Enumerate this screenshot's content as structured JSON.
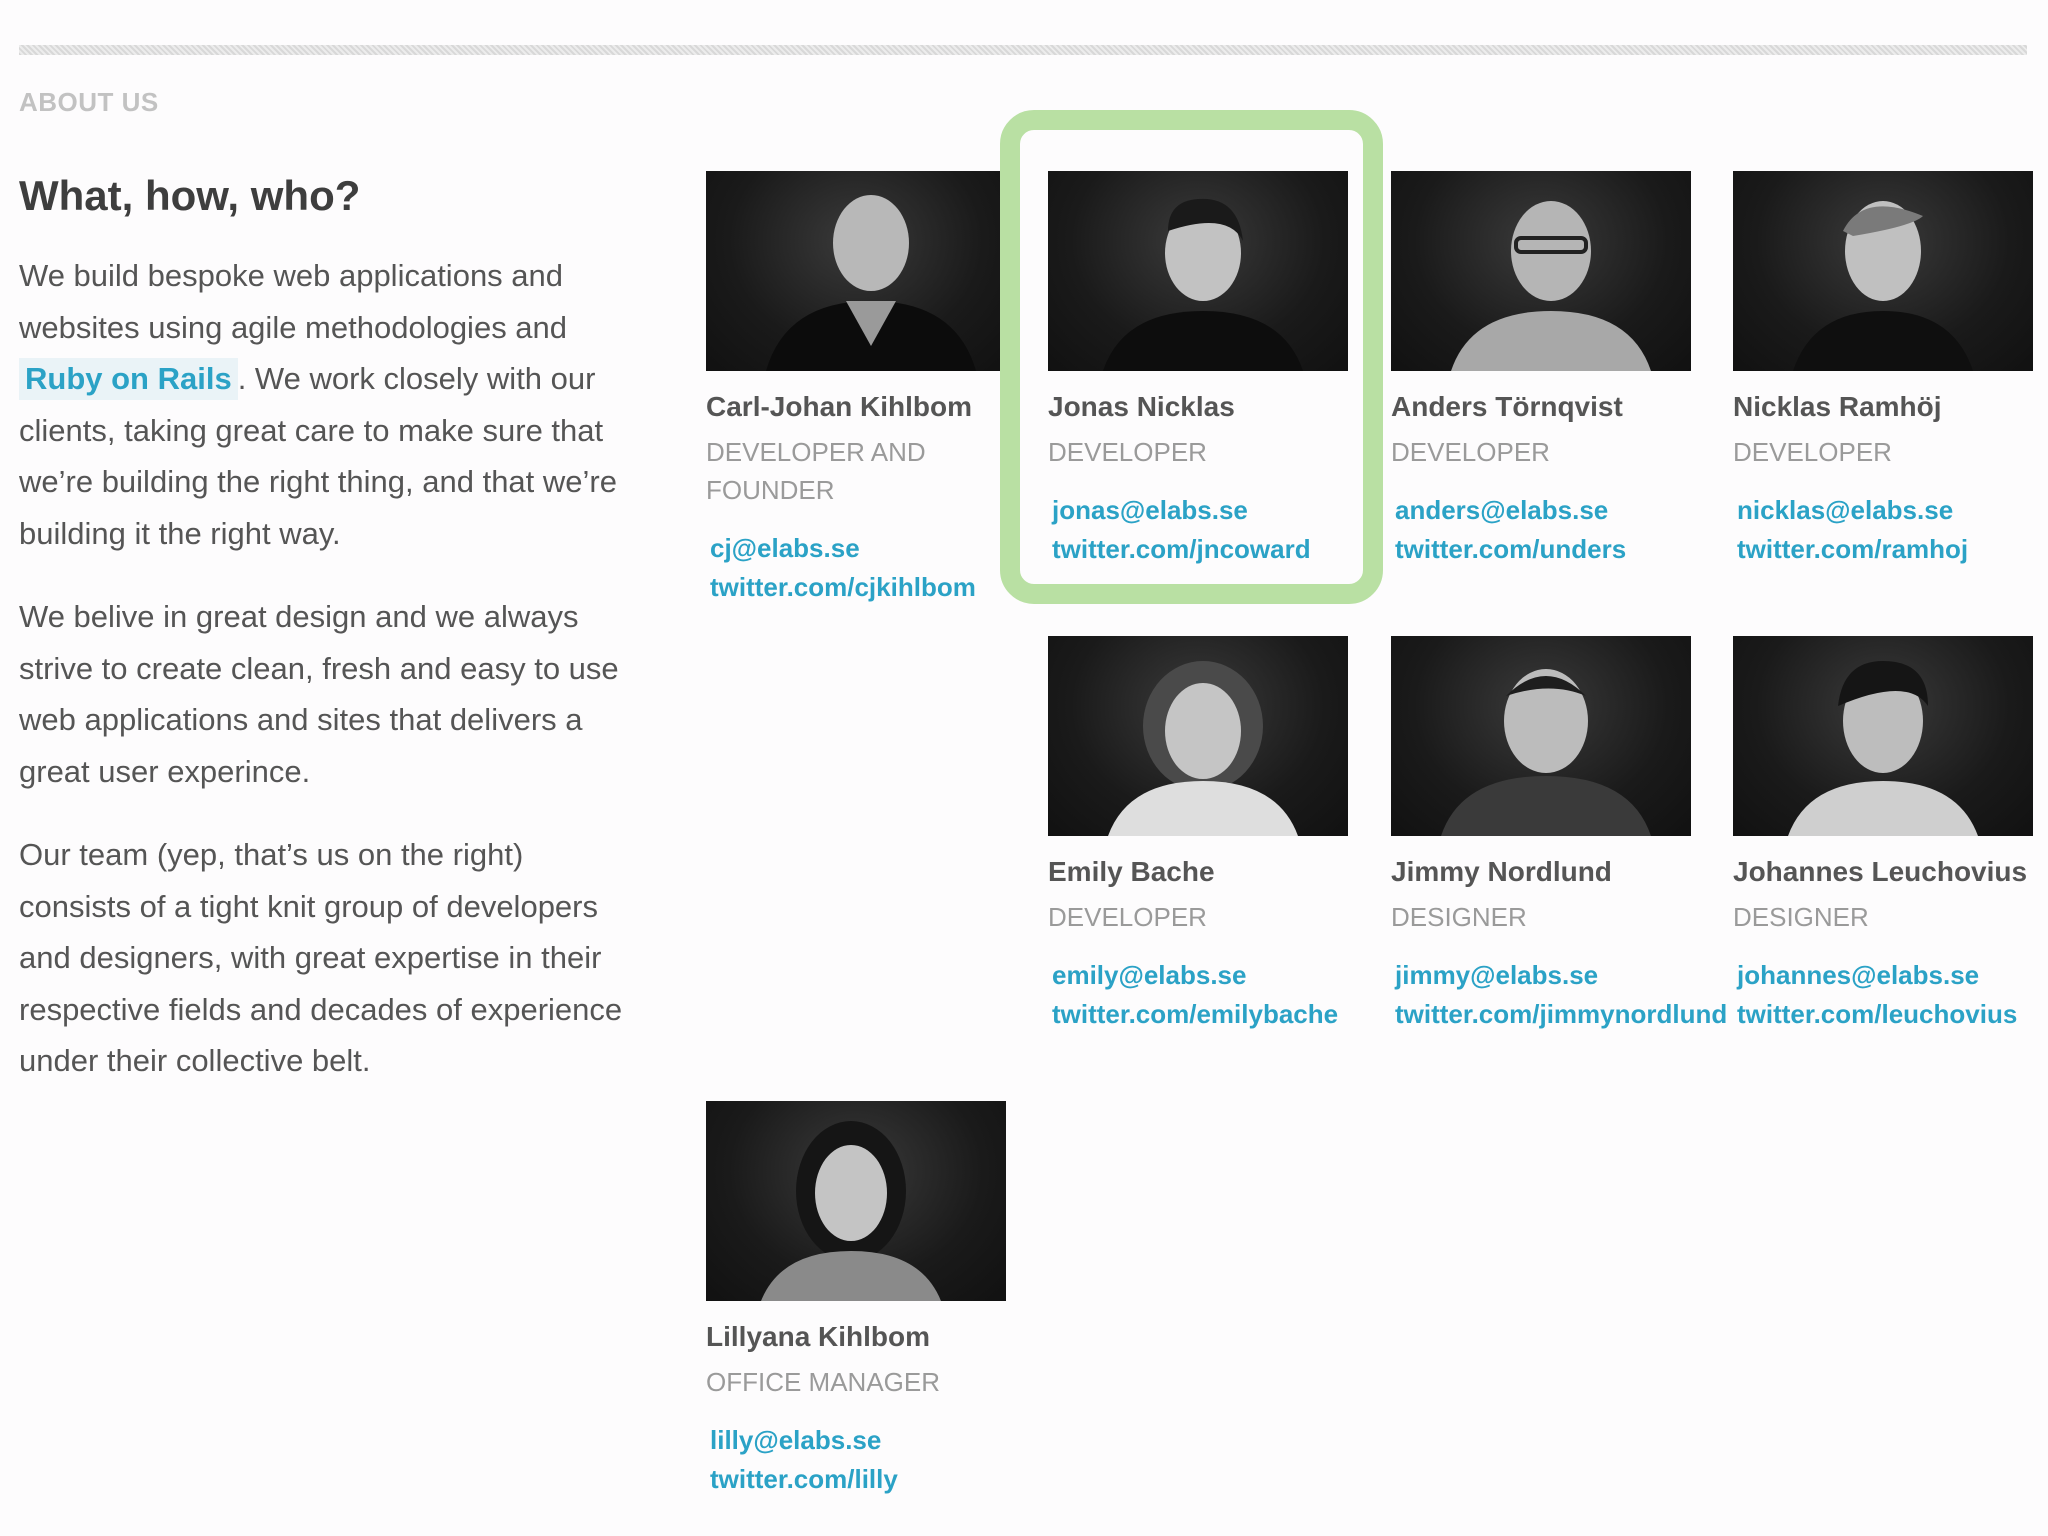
{
  "section_label": "ABOUT US",
  "intro": {
    "title": "What, how, who?",
    "p1_before": "We build bespoke web applications and websites using agile methodologies and",
    "p1_link": "Ruby on Rails",
    "p1_after": ". We work closely with our clients, taking great care to make sure that we’re building the right thing, and that we’re building it the right way.",
    "p2": "We belive in great design and we always strive to create clean, fresh and easy to use web applications and sites that delivers a great user experince.",
    "p3": "Our team (yep, that’s us on the right) consists of a tight knit group of developers and designers, with great expertise in their respective fields and decades of experience under their collective belt."
  },
  "team": [
    {
      "name": "Carl-Johan Kihlbom",
      "role_line1": "DEVELOPER AND",
      "role_line2": "FOUNDER",
      "email": "cj@elabs.se",
      "twitter": "twitter.com/cjkihlbom"
    },
    {
      "name": "Jonas Nicklas",
      "role_line1": "DEVELOPER",
      "role_line2": "",
      "email": "jonas@elabs.se",
      "twitter": "twitter.com/jncoward"
    },
    {
      "name": "Anders Törnqvist",
      "role_line1": "DEVELOPER",
      "role_line2": "",
      "email": "anders@elabs.se",
      "twitter": "twitter.com/unders"
    },
    {
      "name": "Nicklas Ramhöj",
      "role_line1": "DEVELOPER",
      "role_line2": "",
      "email": "nicklas@elabs.se",
      "twitter": "twitter.com/ramhoj"
    },
    {
      "name": "Emily Bache",
      "role_line1": "DEVELOPER",
      "role_line2": "",
      "email": "emily@elabs.se",
      "twitter": "twitter.com/emilybache"
    },
    {
      "name": "Jimmy Nordlund",
      "role_line1": "DESIGNER",
      "role_line2": "",
      "email": "jimmy@elabs.se",
      "twitter": "twitter.com/jimmynordlund"
    },
    {
      "name": "Johannes Leuchovius",
      "role_line1": "DESIGNER",
      "role_line2": "",
      "email": "johannes@elabs.se",
      "twitter": "twitter.com/leuchovius"
    },
    {
      "name": "Lillyana Kihlbom",
      "role_line1": "OFFICE MANAGER",
      "role_line2": "",
      "email": "lilly@elabs.se",
      "twitter": "twitter.com/lilly"
    }
  ],
  "colors": {
    "link": "#2ba2c6",
    "highlight_border": "#b9e0a3",
    "heading": "#3e3e3e"
  }
}
